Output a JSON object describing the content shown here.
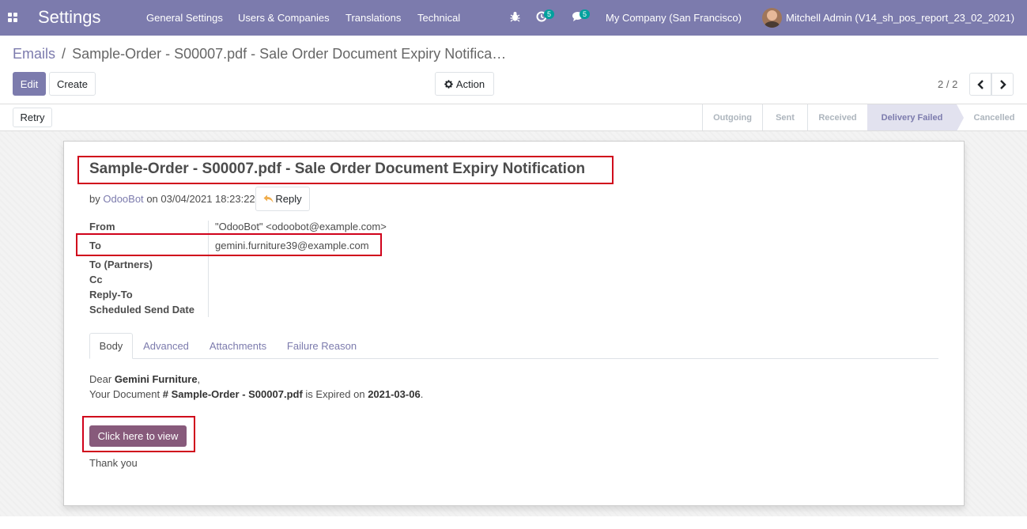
{
  "navbar": {
    "app_title": "Settings",
    "menu": [
      "General Settings",
      "Users & Companies",
      "Translations",
      "Technical"
    ],
    "activity_count": "5",
    "messages_count": "5",
    "company": "My Company (San Francisco)",
    "user": "Mitchell Admin (V14_sh_pos_report_23_02_2021)",
    "colors": {
      "navbar": "#7c7bad",
      "badge": "#00a09d"
    }
  },
  "breadcrumb": {
    "parent": "Emails",
    "separator": "/",
    "current": "Sample-Order - S00007.pdf - Sale Order Document Expiry Notifica…"
  },
  "toolbar": {
    "edit_label": "Edit",
    "create_label": "Create",
    "action_label": "Action",
    "pager_value": "2 / 2"
  },
  "statusbar": {
    "retry_label": "Retry",
    "stages": [
      "Outgoing",
      "Sent",
      "Received",
      "Delivery Failed",
      "Cancelled"
    ],
    "active_stage": "Delivery Failed"
  },
  "mail": {
    "subject": "Sample-Order - S00007.pdf - Sale Order Document Expiry Notification",
    "by_prefix": "by",
    "author": "OdooBot",
    "date_text": "on 03/04/2021 18:23:22",
    "reply_label": "Reply",
    "fields": [
      {
        "label": "From",
        "value": "\"OdooBot\" <odoobot@example.com>"
      },
      {
        "label": "To",
        "value": "gemini.furniture39@example.com"
      },
      {
        "label": "To (Partners)",
        "value": ""
      },
      {
        "label": "Cc",
        "value": ""
      },
      {
        "label": "Reply-To",
        "value": ""
      },
      {
        "label": "Scheduled Send Date",
        "value": ""
      }
    ],
    "tabs": [
      "Body",
      "Advanced",
      "Attachments",
      "Failure Reason"
    ],
    "active_tab": "Body"
  },
  "body": {
    "greeting_prefix": "Dear",
    "customer": "Gemini Furniture",
    "greeting_suffix": ",",
    "line2_prefix": "Your Document",
    "document": "# Sample-Order - S00007.pdf",
    "line2_middle": "is Expired on",
    "expiry_date": "2021-03-06",
    "line2_suffix": ".",
    "view_button": "Click here to view",
    "closing": "Thank you"
  }
}
